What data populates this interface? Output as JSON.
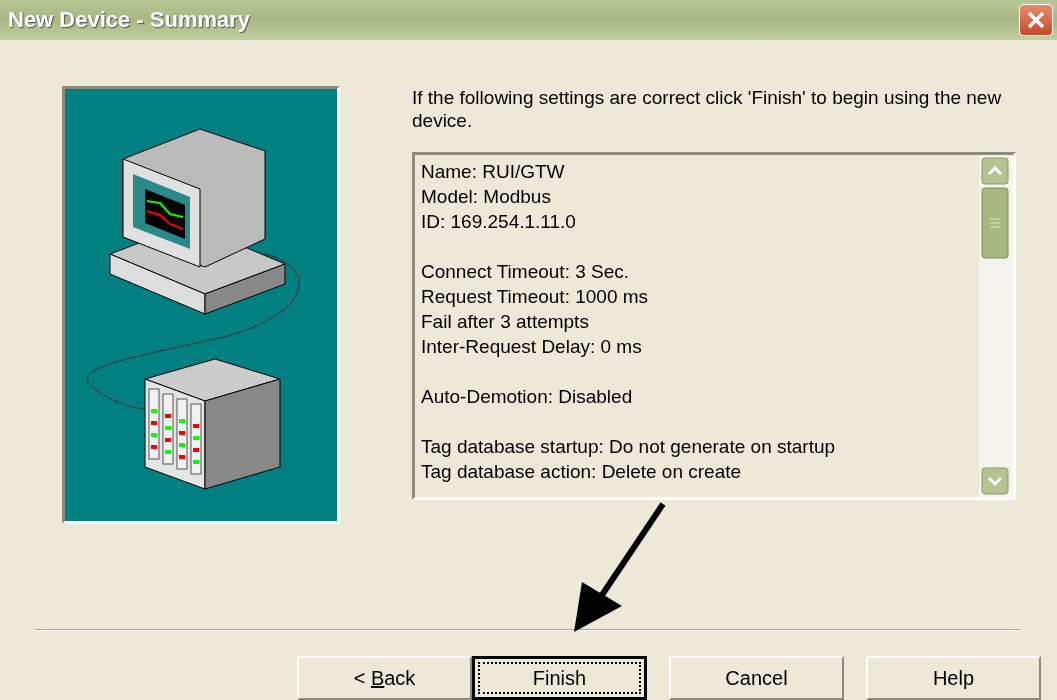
{
  "window": {
    "title": "New Device - Summary"
  },
  "instruction": "If the following settings are correct click 'Finish' to begin using the new device.",
  "summary_groups": [
    [
      "Name: RUI/GTW",
      "Model: Modbus",
      "ID: 169.254.1.11.0"
    ],
    [
      "Connect Timeout: 3 Sec.",
      "Request Timeout: 1000 ms",
      "Fail after 3 attempts",
      "Inter-Request Delay: 0 ms"
    ],
    [
      "Auto-Demotion: Disabled"
    ],
    [
      "Tag database startup: Do not generate on startup",
      "Tag database action: Delete on create"
    ]
  ],
  "buttons": [
    {
      "label_parts": [
        {
          "text": "< ",
          "underlined": false
        },
        {
          "text": "B",
          "underlined": true
        },
        {
          "text": "ack",
          "underlined": false
        }
      ],
      "focused": false
    },
    {
      "label": "Finish",
      "focused": true
    },
    {
      "label": "Cancel",
      "focused": false
    },
    {
      "label": "Help",
      "focused": false
    }
  ]
}
